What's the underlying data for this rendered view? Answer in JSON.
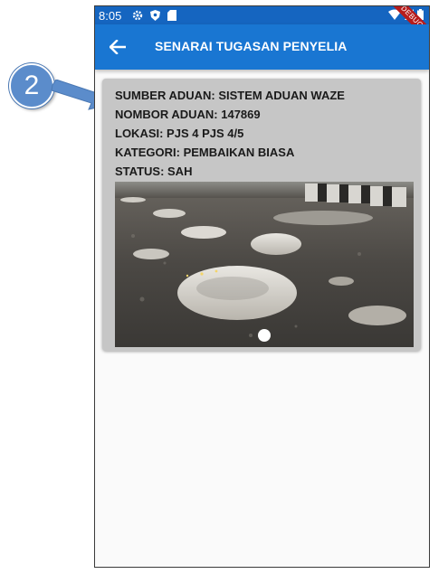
{
  "annotation": {
    "step_number": "2"
  },
  "status_bar": {
    "time": "8:05",
    "debug_label": "DEBUG"
  },
  "app_bar": {
    "title": "SENARAI TUGASAN PENYELIA"
  },
  "card": {
    "lines": [
      "SUMBER ADUAN: SISTEM ADUAN WAZE",
      "NOMBOR ADUAN: 147869",
      "LOKASI: PJS 4 PJS 4/5",
      "KATEGORI: PEMBAIKAN BIASA",
      "STATUS: SAH"
    ],
    "photo": {
      "subject": "potholes-road-photo",
      "page_count": 1,
      "current_page": 1
    }
  },
  "colors": {
    "status_bar": "#1565c0",
    "app_bar": "#1976d2",
    "card_bg": "#c6c6c6",
    "callout": "#5b8ccb"
  }
}
